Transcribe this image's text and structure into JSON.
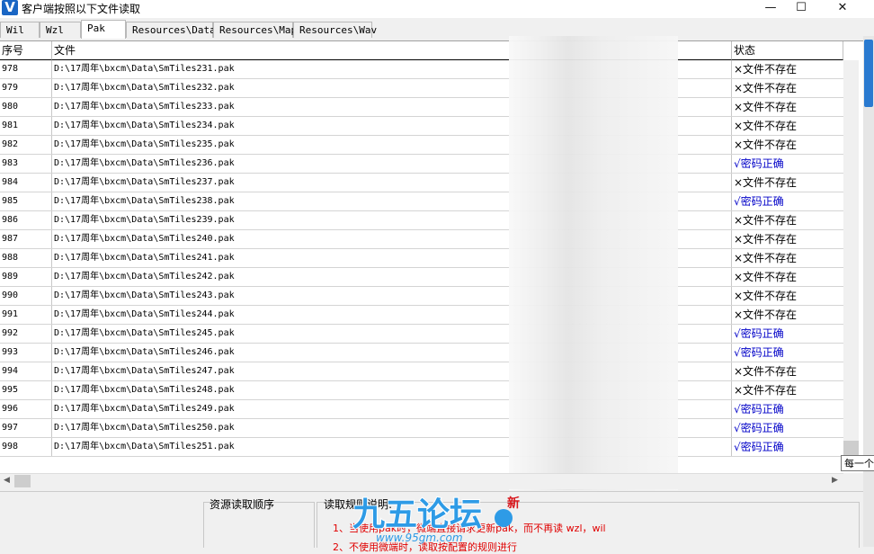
{
  "window": {
    "title": "客户端按照以下文件读取",
    "icon_letter": "V",
    "controls": [
      "—",
      "☐",
      "✕"
    ]
  },
  "tabs": [
    "Wil",
    "Wzl",
    "Pak",
    "Resources\\Data",
    "Resources\\Map",
    "Resources\\Wav"
  ],
  "active_tab": "Pak",
  "columns": {
    "index": "序号",
    "file": "文件",
    "status": "状态"
  },
  "rows": [
    {
      "idx": "978",
      "file": "D:\\17周年\\bxcm\\Data\\SmTiles231.pak",
      "status": "×文件不存在",
      "ok": false
    },
    {
      "idx": "979",
      "file": "D:\\17周年\\bxcm\\Data\\SmTiles232.pak",
      "status": "×文件不存在",
      "ok": false
    },
    {
      "idx": "980",
      "file": "D:\\17周年\\bxcm\\Data\\SmTiles233.pak",
      "status": "×文件不存在",
      "ok": false
    },
    {
      "idx": "981",
      "file": "D:\\17周年\\bxcm\\Data\\SmTiles234.pak",
      "status": "×文件不存在",
      "ok": false
    },
    {
      "idx": "982",
      "file": "D:\\17周年\\bxcm\\Data\\SmTiles235.pak",
      "status": "×文件不存在",
      "ok": false
    },
    {
      "idx": "983",
      "file": "D:\\17周年\\bxcm\\Data\\SmTiles236.pak",
      "status": "√密码正确",
      "ok": true
    },
    {
      "idx": "984",
      "file": "D:\\17周年\\bxcm\\Data\\SmTiles237.pak",
      "status": "×文件不存在",
      "ok": false
    },
    {
      "idx": "985",
      "file": "D:\\17周年\\bxcm\\Data\\SmTiles238.pak",
      "status": "√密码正确",
      "ok": true
    },
    {
      "idx": "986",
      "file": "D:\\17周年\\bxcm\\Data\\SmTiles239.pak",
      "status": "×文件不存在",
      "ok": false
    },
    {
      "idx": "987",
      "file": "D:\\17周年\\bxcm\\Data\\SmTiles240.pak",
      "status": "×文件不存在",
      "ok": false
    },
    {
      "idx": "988",
      "file": "D:\\17周年\\bxcm\\Data\\SmTiles241.pak",
      "status": "×文件不存在",
      "ok": false
    },
    {
      "idx": "989",
      "file": "D:\\17周年\\bxcm\\Data\\SmTiles242.pak",
      "status": "×文件不存在",
      "ok": false
    },
    {
      "idx": "990",
      "file": "D:\\17周年\\bxcm\\Data\\SmTiles243.pak",
      "status": "×文件不存在",
      "ok": false
    },
    {
      "idx": "991",
      "file": "D:\\17周年\\bxcm\\Data\\SmTiles244.pak",
      "status": "×文件不存在",
      "ok": false
    },
    {
      "idx": "992",
      "file": "D:\\17周年\\bxcm\\Data\\SmTiles245.pak",
      "status": "√密码正确",
      "ok": true
    },
    {
      "idx": "993",
      "file": "D:\\17周年\\bxcm\\Data\\SmTiles246.pak",
      "status": "√密码正确",
      "ok": true
    },
    {
      "idx": "994",
      "file": "D:\\17周年\\bxcm\\Data\\SmTiles247.pak",
      "status": "×文件不存在",
      "ok": false
    },
    {
      "idx": "995",
      "file": "D:\\17周年\\bxcm\\Data\\SmTiles248.pak",
      "status": "×文件不存在",
      "ok": false
    },
    {
      "idx": "996",
      "file": "D:\\17周年\\bxcm\\Data\\SmTiles249.pak",
      "status": "√密码正确",
      "ok": true
    },
    {
      "idx": "997",
      "file": "D:\\17周年\\bxcm\\Data\\SmTiles250.pak",
      "status": "√密码正确",
      "ok": true
    },
    {
      "idx": "998",
      "file": "D:\\17周年\\bxcm\\Data\\SmTiles251.pak",
      "status": "√密码正确",
      "ok": true
    }
  ],
  "tooltip": "每一个",
  "bottom": {
    "order_label": "资源读取顺序",
    "rules_label": "读取规则说明:",
    "rule1": "1、当使用pak时，微端直接请求更新pak，而不再读 wzl，wil",
    "rule2": "2、不使用微端时，读取按配置的规则进行"
  },
  "watermark": {
    "text": "九五论坛",
    "url": "www.95gm.com",
    "badge": "新"
  },
  "colors": {
    "ok": "#0000c8",
    "missing": "#000000",
    "rule": "#e00000",
    "accent": "#1a66c4"
  },
  "icons": {
    "minimize": "minimize-icon",
    "maximize": "maximize-icon",
    "close": "close-icon"
  }
}
